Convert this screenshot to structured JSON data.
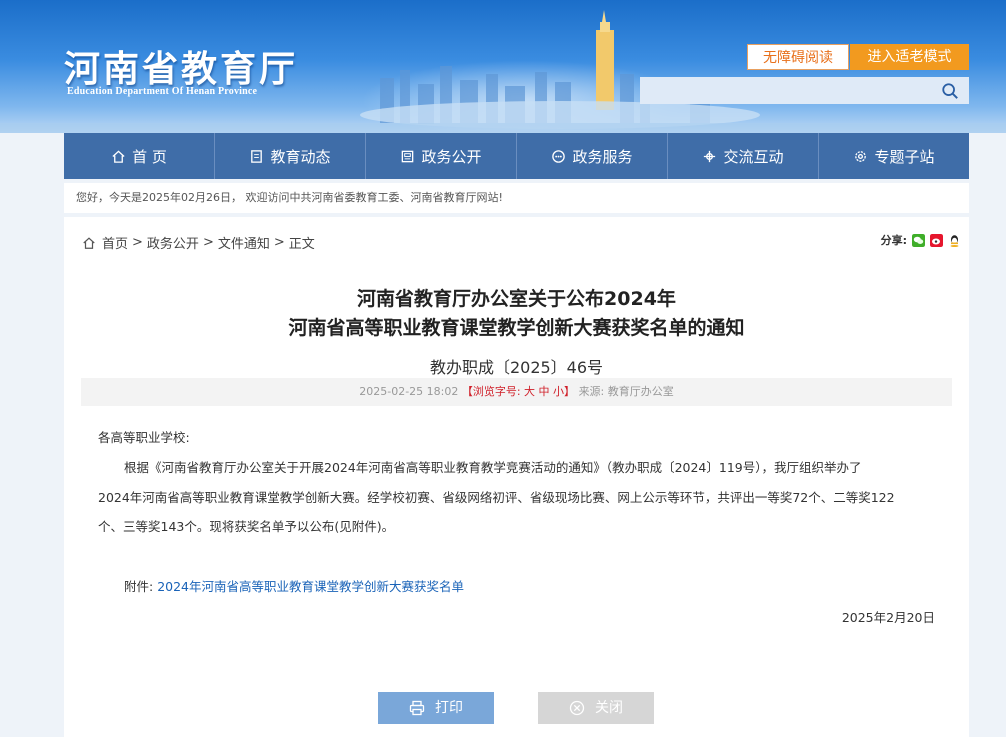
{
  "header": {
    "logo_cn": "河南省教育厅",
    "logo_en": "Education Department Of Henan Province",
    "accessibility_label": "无障碍阅读",
    "elder_mode_label": "进入适老模式",
    "search_placeholder": ""
  },
  "nav": {
    "items": [
      {
        "label": "首 页",
        "icon": "home-icon"
      },
      {
        "label": "教育动态",
        "icon": "news-icon"
      },
      {
        "label": "政务公开",
        "icon": "document-icon"
      },
      {
        "label": "政务服务",
        "icon": "service-icon"
      },
      {
        "label": "交流互动",
        "icon": "interaction-icon"
      },
      {
        "label": "专题子站",
        "icon": "gear-icon"
      }
    ]
  },
  "welcome_text": "您好，今天是2025年02月26日， 欢迎访问中共河南省委教育工委、河南省教育厅网站!",
  "breadcrumb": {
    "home": "首页",
    "sep1": ">",
    "level1": "政务公开",
    "sep2": ">",
    "level2": "文件通知",
    "sep3": ">",
    "current": "正文"
  },
  "share_label": "分享:",
  "article": {
    "title_line1": "河南省教育厅办公室关于公布2024年",
    "title_line2": "河南省高等职业教育课堂教学创新大赛获奖名单的通知",
    "doc_number": "教办职成〔2025〕46号",
    "date_time": "2025-02-25 18:02",
    "font_size_label": "【浏览字号: 大 中 小】",
    "source": "来源: 教育厅办公室",
    "salutation": "各高等职业学校:",
    "para1_l1": "根据《河南省教育厅办公室关于开展2024年河南省高等职业教育教学竞赛活动的通知》（教办职成〔2024〕119号），我厅组织举办了",
    "para1_l2": "2024年河南省高等职业教育课堂教学创新大赛。经学校初赛、省级网络初评、省级现场比赛、网上公示等环节，共评出一等奖72个、二等奖122",
    "para1_l3": "个、三等奖143个。现将获奖名单予以公布(见附件)。",
    "attachment_label": "附件:",
    "attachment_link": "2024年河南省高等职业教育课堂教学创新大赛获奖名单",
    "sign_date": "2025年2月20日"
  },
  "actions": {
    "print_label": "打印",
    "close_label": "关闭"
  },
  "colors": {
    "nav_bg": "#3f6da8",
    "elder_btn": "#f29a1f",
    "link": "#1a63b8",
    "red": "#d0202a"
  }
}
